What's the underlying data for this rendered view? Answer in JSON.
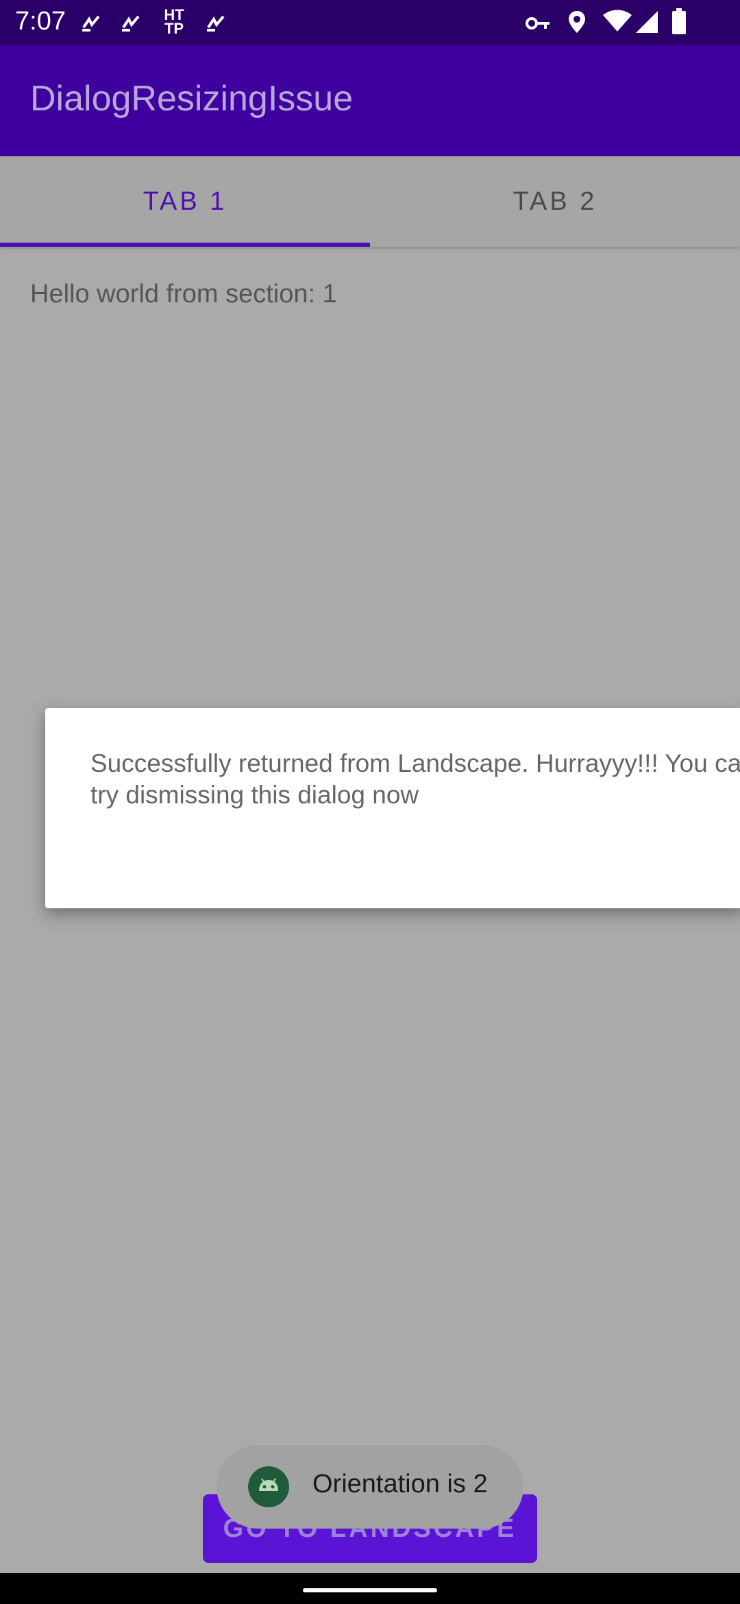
{
  "status_bar": {
    "time": "7:07",
    "notification_icons": [
      "activity-icon",
      "activity-icon",
      "http-icon",
      "activity-icon"
    ],
    "notification_http": "HT\nTP",
    "right_icons": [
      "vpn-key-icon",
      "location-icon",
      "wifi-icon",
      "signal-icon",
      "battery-icon"
    ]
  },
  "app_bar": {
    "title": "DialogResizingIssue"
  },
  "tabs": [
    {
      "label": "TAB 1",
      "selected": true
    },
    {
      "label": "TAB 2",
      "selected": false
    }
  ],
  "section_text": "Hello world from section: 1",
  "dialog": {
    "message": "Successfully returned from Landscape. Hurrayyy!!! You can try dismissing this dialog now"
  },
  "main_button": {
    "label": "GO TO LANDSCAPE"
  },
  "toast": {
    "text": "Orientation is 2",
    "icon": "android-icon"
  },
  "colors": {
    "status_bar": "#2a0068",
    "app_bar": "#3f00a0",
    "accent": "#4a10b0",
    "scrim": "#aaaaaa",
    "button": "#5b14d6"
  }
}
